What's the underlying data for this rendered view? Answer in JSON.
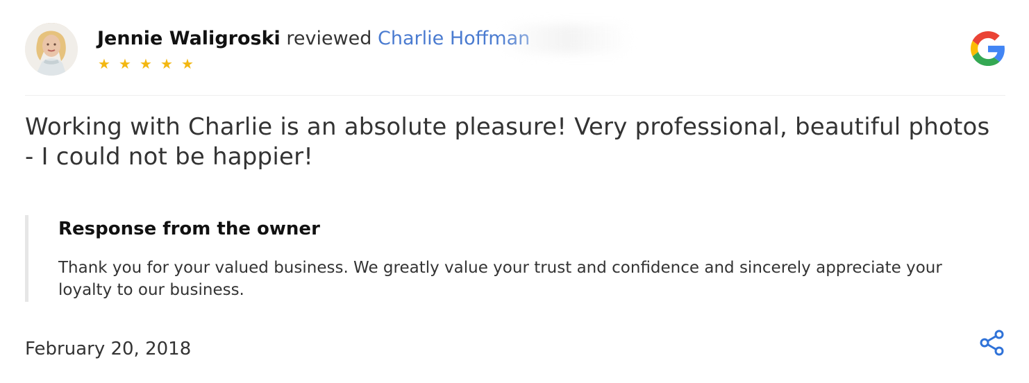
{
  "review": {
    "reviewer_name": "Jennie Waligroski",
    "review_verb": "reviewed",
    "business_name": "Charlie Hoffman",
    "rating": 5,
    "rating_max": 5,
    "text": "Working with Charlie is an absolute pleasure! Very professional, beautiful photos - I could not be happier!",
    "date": "February 20, 2018"
  },
  "owner_response": {
    "title": "Response from the owner",
    "text": "Thank you for your valued business. We greatly value your trust and confidence and sincerely appreciate your loyalty to our business."
  },
  "icons": {
    "provider": "google-icon",
    "share": "share-icon",
    "star": "star-icon"
  },
  "colors": {
    "link": "#4a7bd0",
    "star": "#f3b711",
    "share": "#2f72d8",
    "google_blue": "#4285f4",
    "google_red": "#ea4335",
    "google_yellow": "#fbbc05",
    "google_green": "#34a853",
    "divider": "#efefef"
  }
}
